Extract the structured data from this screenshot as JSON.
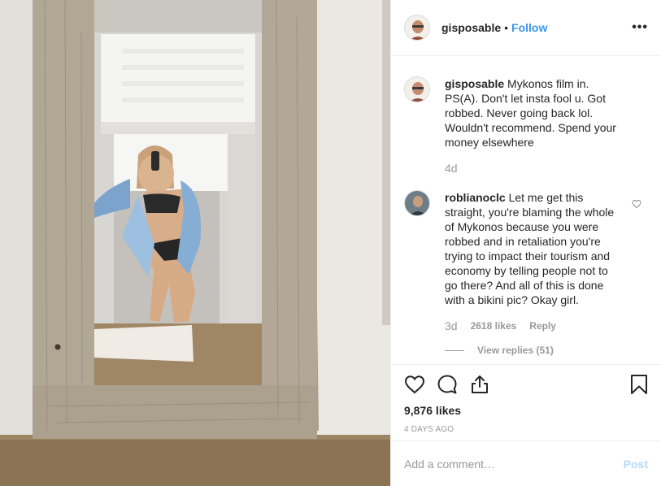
{
  "post": {
    "author": "gisposable",
    "separator": "•",
    "follow_label": "Follow",
    "more_label": "•••",
    "photo_icon": "mirror-selfie-photo"
  },
  "comments": [
    {
      "user": "gisposable",
      "text": "Mykonos film in. PS(A). Don't let insta fool u. Got robbed. Never going back lol. Wouldn't recommend. Spend your money elsewhere",
      "time": "4d"
    },
    {
      "user": "roblianoclc",
      "text": "Let me get this straight, you're blaming the whole of Mykonos because you were robbed and in retaliation you're trying to impact their tourism and economy by telling people not to go there? And all of this is done with a bikini pic? Okay girl.",
      "time": "3d",
      "likes": "2618 likes",
      "reply_label": "Reply",
      "view_replies": "View replies (51)"
    }
  ],
  "actions": {
    "icons": [
      "heart-icon",
      "comment-icon",
      "share-icon",
      "bookmark-icon"
    ],
    "likes": "9,876 likes",
    "date": "4 DAYS AGO"
  },
  "add_comment": {
    "placeholder": "Add a comment…",
    "post_label": "Post"
  },
  "colors": {
    "link": "#3897f0",
    "post_disabled": "#b3dbff",
    "muted": "#999999",
    "text": "#262626"
  }
}
